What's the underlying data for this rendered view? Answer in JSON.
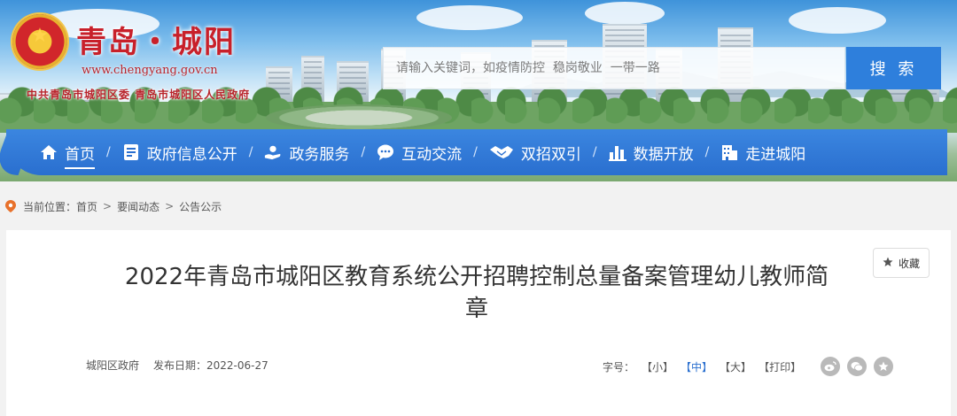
{
  "header": {
    "site_title": "青岛・城阳",
    "site_url": "www.chengyang.gov.cn",
    "site_subtitle": "中共青岛市城阳区委   青岛市城阳区人民政府",
    "search_placeholder": "请输入关键词，如疫情防控  稳岗敬业  一带一路",
    "search_button": "搜 索"
  },
  "nav": {
    "items": [
      {
        "label": "首页",
        "icon": "home-icon"
      },
      {
        "label": "政府信息公开",
        "icon": "document-icon"
      },
      {
        "label": "政务服务",
        "icon": "hand-service-icon"
      },
      {
        "label": "互动交流",
        "icon": "chat-icon"
      },
      {
        "label": "双招双引",
        "icon": "handshake-icon"
      },
      {
        "label": "数据开放",
        "icon": "bar-chart-icon"
      },
      {
        "label": "走进城阳",
        "icon": "building-icon"
      }
    ],
    "separator": "/"
  },
  "breadcrumb": {
    "prefix": "当前位置：",
    "items": [
      "首页",
      "要闻动态",
      "公告公示"
    ],
    "separator": ">"
  },
  "article": {
    "title_line1": "2022年青岛市城阳区教育系统公开招聘控制总量备案管理幼儿教师简",
    "title_line2": "章",
    "favorite_label": "收藏",
    "source": "城阳区政府",
    "date": "发布日期：2022-06-27",
    "font_size_label": "字号：",
    "font_sizes": [
      "【小】",
      "【中】",
      "【大】"
    ],
    "print_label": "【打印】"
  },
  "colors": {
    "nav_blue": "#2a6fcf",
    "search_button": "#2e7fdc",
    "title_red": "#c8202a"
  }
}
